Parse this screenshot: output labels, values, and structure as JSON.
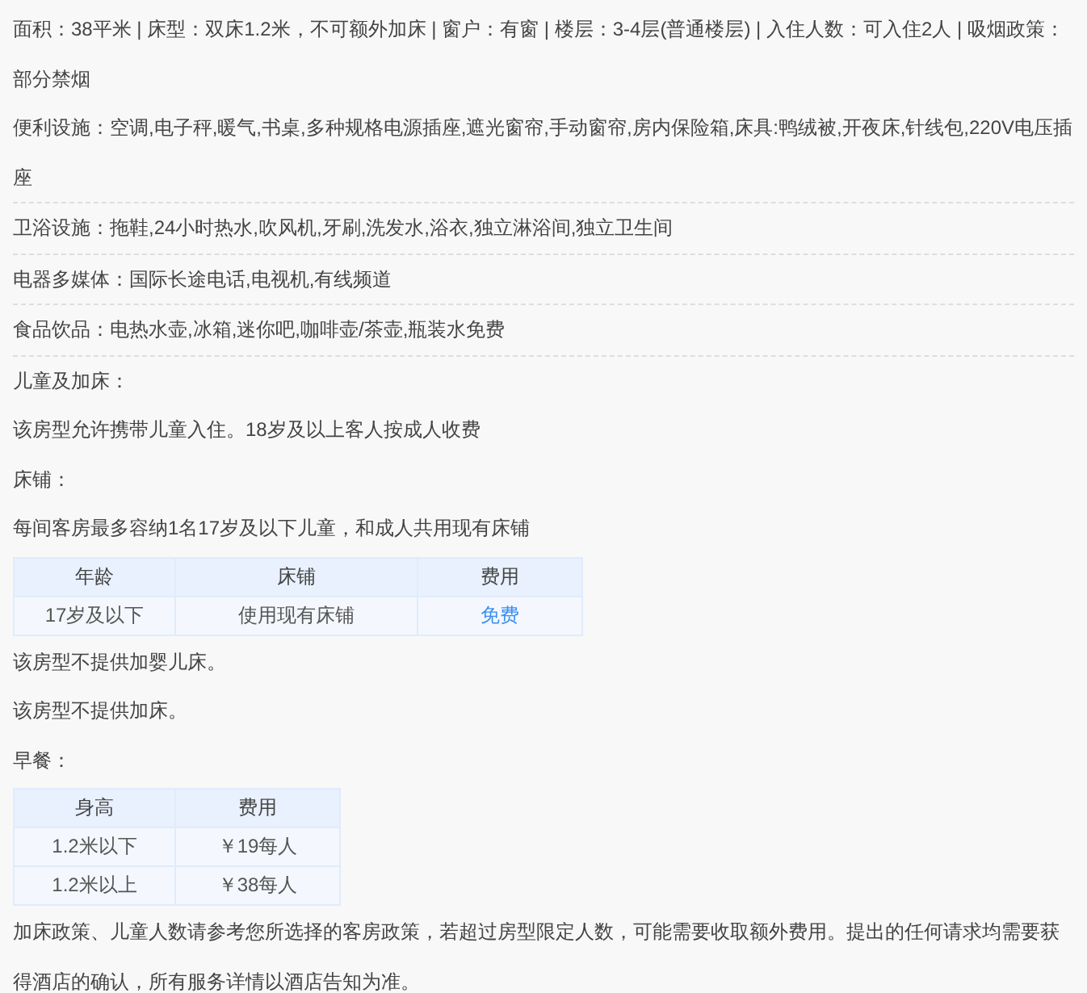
{
  "blocks": [
    {
      "kind": "text",
      "text": "面积：38平米 | 床型：双床1.2米，不可额外加床 | 窗户：有窗 | 楼层：3-4层(普通楼层) | 入住人数：可入住2人 | 吸烟政策：部分禁烟"
    },
    {
      "kind": "facility",
      "text": "便利设施：空调,电子秤,暖气,书桌,多种规格电源插座,遮光窗帘,手动窗帘,房内保险箱,床具:鸭绒被,开夜床,针线包,220V电压插座"
    },
    {
      "kind": "facility",
      "text": "卫浴设施：拖鞋,24小时热水,吹风机,牙刷,洗发水,浴衣,独立淋浴间,独立卫生间"
    },
    {
      "kind": "facility",
      "text": "电器多媒体：国际长途电话,电视机,有线频道"
    },
    {
      "kind": "facility",
      "text": "食品饮品：电热水壶,冰箱,迷你吧,咖啡壶/茶壶,瓶装水免费"
    },
    {
      "kind": "text",
      "text": "儿童及加床："
    },
    {
      "kind": "text",
      "text": "该房型允许携带儿童入住。18岁及以上客人按成人收费"
    },
    {
      "kind": "text",
      "text": "床铺："
    },
    {
      "kind": "text",
      "text": "每间客房最多容纳1名17岁及以下儿童，和成人共用现有床铺"
    },
    {
      "kind": "table",
      "columns": [
        "年龄",
        "床铺",
        "费用"
      ],
      "rows": [
        [
          {
            "text": "17岁及以下",
            "highlight": false
          },
          {
            "text": "使用现有床铺",
            "highlight": false
          },
          {
            "text": "免费",
            "highlight": true
          }
        ]
      ]
    },
    {
      "kind": "text",
      "text": "该房型不提供加婴儿床。"
    },
    {
      "kind": "text",
      "text": "该房型不提供加床。"
    },
    {
      "kind": "text",
      "text": "早餐："
    },
    {
      "kind": "table",
      "columns": [
        "身高",
        "费用"
      ],
      "rows": [
        [
          {
            "text": "1.2米以下",
            "highlight": false
          },
          {
            "text": "￥19每人",
            "highlight": false
          }
        ],
        [
          {
            "text": "1.2米以上",
            "highlight": false
          },
          {
            "text": "￥38每人",
            "highlight": false
          }
        ]
      ]
    },
    {
      "kind": "text",
      "text": "加床政策、儿童人数请参考您所选择的客房政策，若超过房型限定人数，可能需要收取额外费用。提出的任何请求均需要获得酒店的确认，所有服务详情以酒店告知为准。"
    }
  ]
}
